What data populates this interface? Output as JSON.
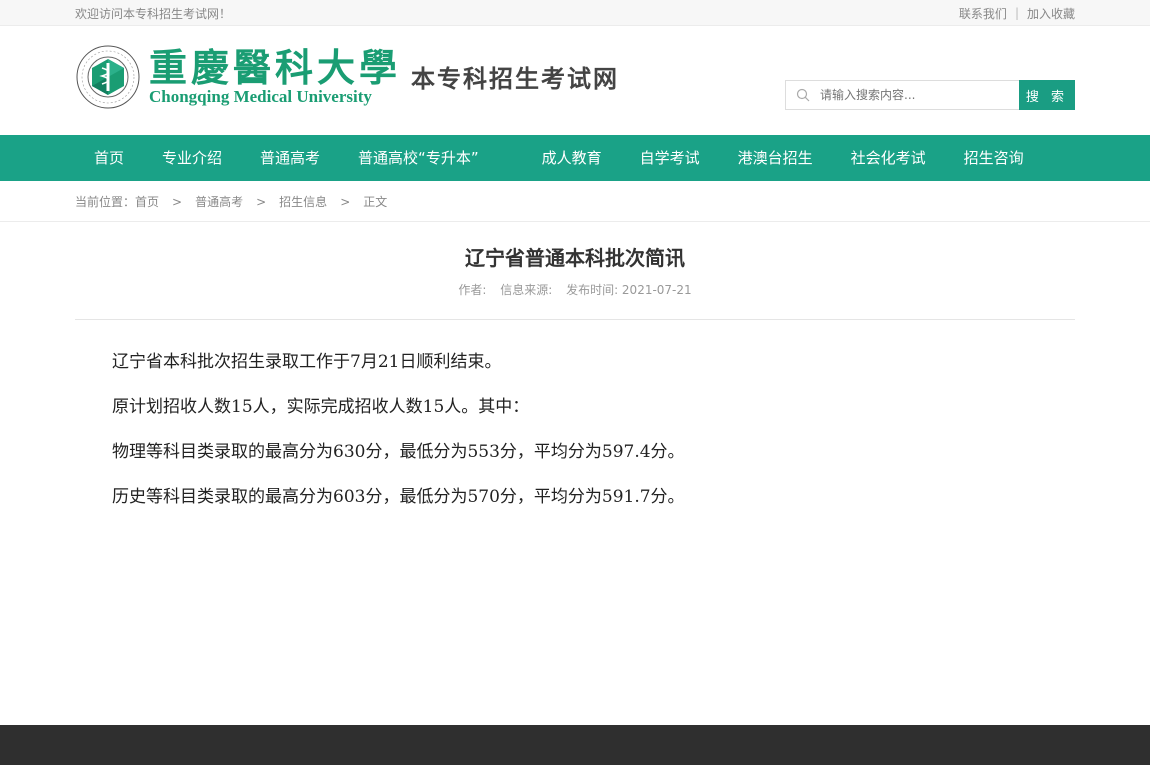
{
  "topbar": {
    "welcome": "欢迎访问本专科招生考试网！",
    "contact": "联系我们",
    "separator": "|",
    "favorite": "加入收藏"
  },
  "header": {
    "university_cn": "重慶醫科大學",
    "university_en": "Chongqing Medical University",
    "site_name": "本专科招生考试网",
    "emblem_text": "重庆医科大学 Chongqing Medical University"
  },
  "search": {
    "placeholder": "请输入搜索内容...",
    "button": "搜 索"
  },
  "nav": {
    "items": [
      "首页",
      "专业介绍",
      "普通高考",
      "普通高校“专升本”",
      "成人教育",
      "自学考试",
      "港澳台招生",
      "社会化考试",
      "招生咨询"
    ]
  },
  "breadcrumb": {
    "label": "当前位置：",
    "items": [
      "首页",
      "普通高考",
      "招生信息",
      "正文"
    ],
    "separator": ">"
  },
  "article": {
    "title": "辽宁省普通本科批次简讯",
    "author_label": "作者:",
    "source_label": "信息来源:",
    "date_label": "发布时间: 2021-07-21",
    "paragraphs": [
      "辽宁省本科批次招生录取工作于7月21日顺利结束。",
      "原计划招收人数15人，实际完成招收人数15人。其中：",
      "物理等科目类录取的最高分为630分，最低分为553分，平均分为597.4分。",
      "历史等科目类录取的最高分为603分，最低分为570分，平均分为591.7分。"
    ]
  },
  "colors": {
    "brand_green": "#1aa287",
    "footer": "#2f2f2f"
  }
}
